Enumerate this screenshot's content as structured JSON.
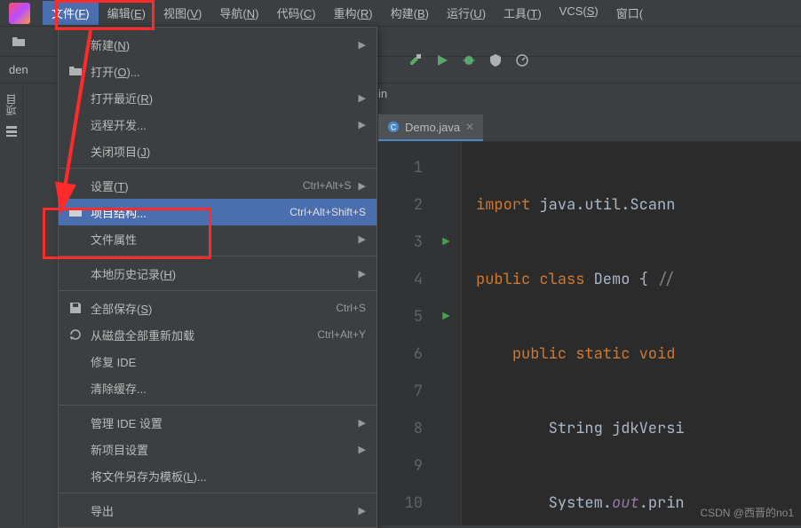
{
  "menubar": {
    "items": [
      {
        "label": "文件(<u>F</u>)",
        "active": true
      },
      {
        "label": "编辑(<u>E</u>)"
      },
      {
        "label": "视图(<u>V</u>)"
      },
      {
        "label": "导航(<u>N</u>)"
      },
      {
        "label": "代码(<u>C</u>)"
      },
      {
        "label": "重构(<u>R</u>)"
      },
      {
        "label": "构建(<u>B</u>)"
      },
      {
        "label": "运行(<u>U</u>)"
      },
      {
        "label": "工具(<u>T</u>)"
      },
      {
        "label": "VCS(<u>S</u>)"
      },
      {
        "label": "窗口("
      }
    ]
  },
  "dropdown": {
    "groups": [
      [
        {
          "label": "新建(<u>N</u>)",
          "submenu": true
        },
        {
          "label": "打开(<u>O</u>)...",
          "icon": "open"
        },
        {
          "label": "打开最近(<u>R</u>)",
          "submenu": true
        },
        {
          "label": "远程开发...",
          "submenu": true
        },
        {
          "label": "关闭项目(<u>J</u>)"
        }
      ],
      [
        {
          "label": "设置(<u>T</u>)",
          "shortcut": "Ctrl+Alt+S",
          "submenu": true
        },
        {
          "label": "项目结构...",
          "shortcut": "Ctrl+Alt+Shift+S",
          "icon": "folder",
          "selected": true
        },
        {
          "label": "文件属性",
          "submenu": true
        }
      ],
      [
        {
          "label": "本地历史记录(<u>H</u>)",
          "submenu": true
        }
      ],
      [
        {
          "label": "全部保存(<u>S</u>)",
          "shortcut": "Ctrl+S",
          "icon": "save"
        },
        {
          "label": "从磁盘全部重新加载",
          "shortcut": "Ctrl+Alt+Y",
          "icon": "reload"
        },
        {
          "label": "修复 IDE"
        },
        {
          "label": "清除缓存..."
        }
      ],
      [
        {
          "label": "管理 IDE 设置",
          "submenu": true
        },
        {
          "label": "新项目设置",
          "submenu": true
        },
        {
          "label": "将文件另存为模板(<u>L</u>)..."
        }
      ],
      [
        {
          "label": "导出",
          "submenu": true
        }
      ]
    ]
  },
  "nav": {
    "fragment": "in"
  },
  "tab": {
    "filename": "Demo.java"
  },
  "breadcrumb": {
    "root": "den"
  },
  "leftrail": {
    "project": "项目"
  },
  "editor": {
    "lines": [
      "1",
      "2",
      "3",
      "4",
      "5",
      "6",
      "7",
      "8",
      "9",
      "10"
    ],
    "code": {
      "l1_a": "import",
      "l1_b": " java.util.Scann",
      "l3_a": "public class",
      "l3_b": " Demo { ",
      "l3_c": "//",
      "l5_a": "public static void",
      "l7_a": "String jdkVersi",
      "l9_a": "System.",
      "l9_b": "out",
      "l9_c": ".prin"
    }
  },
  "watermark": "CSDN @西晋的no1"
}
